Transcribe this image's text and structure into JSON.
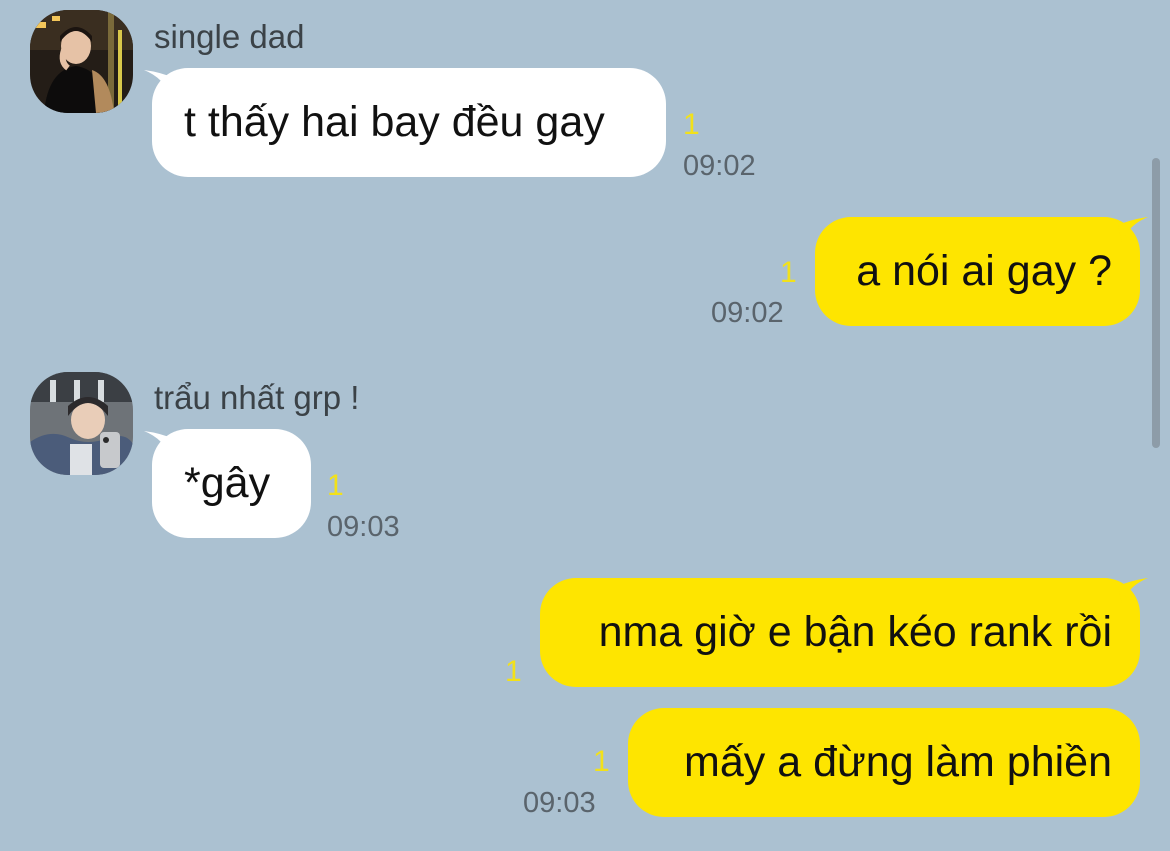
{
  "messages": [
    {
      "sender": "single dad",
      "text": "t thấy hai bay đều gay",
      "unread": "1",
      "time": "09:02"
    },
    {
      "text": "a nói ai gay ?",
      "unread": "1",
      "time": "09:02"
    },
    {
      "sender": "trẩu nhất grp !",
      "text": "*gây",
      "unread": "1",
      "time": "09:03"
    },
    {
      "text": "nma giờ e bận kéo rank rồi",
      "unread": "1"
    },
    {
      "text": "mấy a đừng làm phiền",
      "unread": "1",
      "time": "09:03"
    }
  ],
  "colors": {
    "background": "#abc1d1",
    "incoming_bubble": "#ffffff",
    "outgoing_bubble": "#fee500",
    "unread_count": "#f2e11a",
    "timestamp": "#5a646c"
  }
}
